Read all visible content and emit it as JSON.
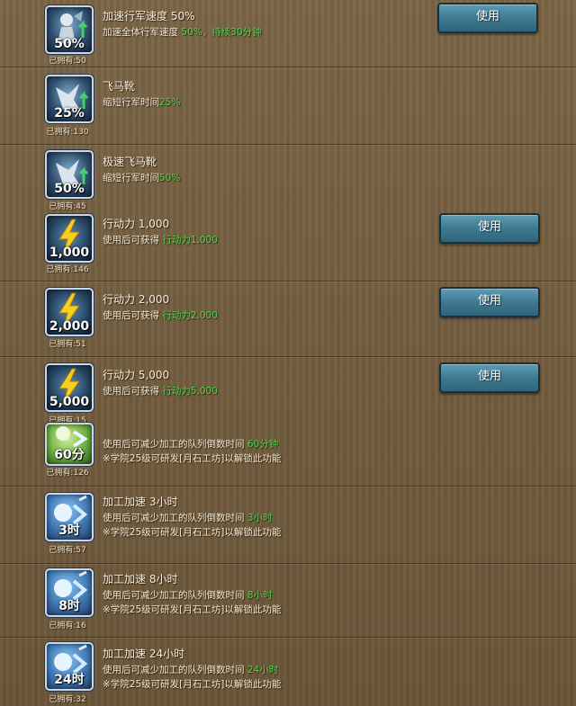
{
  "items": [
    {
      "title": "加速行军速度 50%",
      "desc_pre": "加速全体行军速度",
      "desc_hl": "50%，持续30分钟",
      "icon_label": "50%",
      "owned": "已拥有:50",
      "button": "使用"
    },
    {
      "title": "飞马靴",
      "desc_pre": "缩短行军时间",
      "desc_hl": "25%",
      "icon_label": "25%",
      "owned": "已拥有:130"
    },
    {
      "title": "极速飞马靴",
      "desc_pre": "缩短行军时间",
      "desc_hl": "50%",
      "icon_label": "50%",
      "owned": "已拥有:45"
    },
    {
      "title": "行动力 1,000",
      "desc_pre": "使用后可获得",
      "desc_hl": "行动力1,000",
      "icon_label": "1,000",
      "owned": "已拥有:146",
      "button": "使用"
    },
    {
      "title": "行动力 2,000",
      "desc_pre": "使用后可获得",
      "desc_hl": "行动力2,000",
      "icon_label": "2,000",
      "owned": "已拥有:51",
      "button": "使用"
    },
    {
      "title": "行动力 5,000",
      "desc_pre": "使用后可获得",
      "desc_hl": "行动力5,000",
      "icon_label": "5,000",
      "owned": "已拥有:15",
      "button": "使用"
    },
    {
      "desc_pre": "使用后可减少加工的队列倒数时间",
      "desc_hl": "60分钟",
      "note": "※学院25级可研发[月石工坊]以解锁此功能",
      "icon_label": "60分",
      "owned": "已拥有:126"
    },
    {
      "title": "加工加速 3小时",
      "desc_pre": "使用后可减少加工的队列倒数时间",
      "desc_hl": "3小时",
      "note": "※学院25级可研发[月石工坊]以解锁此功能",
      "icon_label": "3时",
      "owned": "已拥有:57"
    },
    {
      "title": "加工加速 8小时",
      "desc_pre": "使用后可减少加工的队列倒数时间",
      "desc_hl": "8小时",
      "note": "※学院25级可研发[月石工坊]以解锁此功能",
      "icon_label": "8时",
      "owned": "已拥有:16"
    },
    {
      "title": "加工加速 24小时",
      "desc_pre": "使用后可减少加工的队列倒数时间",
      "desc_hl": "24小时",
      "note": "※学院25级可研发[月石工坊]以解锁此功能",
      "icon_label": "24时",
      "owned": "已拥有:32"
    }
  ],
  "colors": {
    "highlight": "#4cd64c",
    "button": "#3d7a92"
  },
  "icons": [
    "knight-boots-icon",
    "winged-boots-icon",
    "winged-boots-icon",
    "lightning-icon",
    "lightning-icon",
    "lightning-icon",
    "crystal-hammer-icon",
    "crystal-hammer-icon",
    "crystal-hammer-icon",
    "crystal-hammer-icon"
  ]
}
